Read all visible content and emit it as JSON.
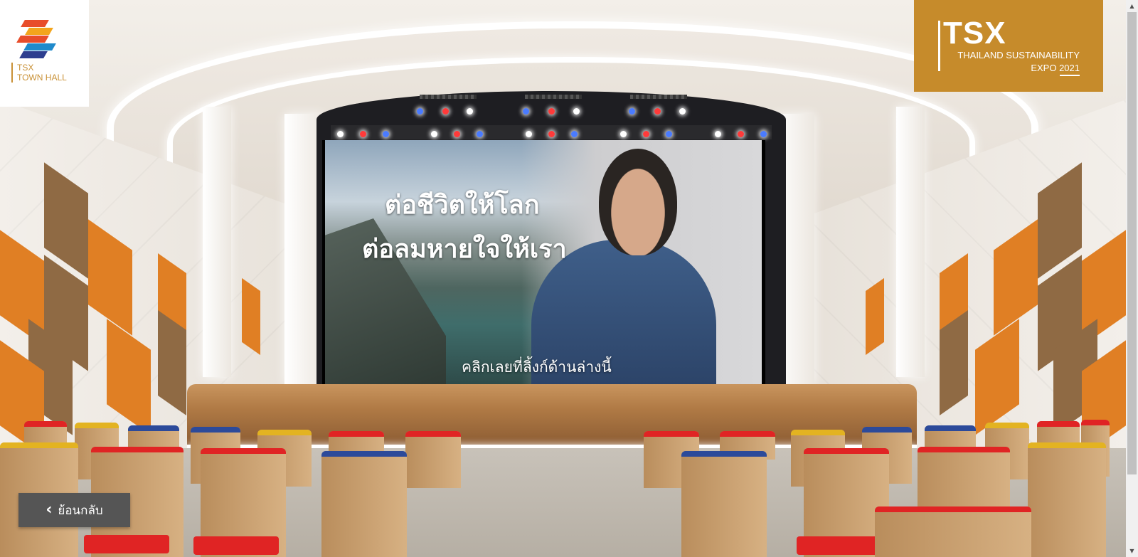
{
  "brand_left": {
    "line1": "TSX",
    "line2": "TOWN HALL",
    "colors": [
      "#e84d2a",
      "#f3a51c",
      "#1f8acb",
      "#2d3e8f",
      "#56b146"
    ]
  },
  "brand_right": {
    "big": "TSX",
    "line1": "THAILAND SUSTAINABILITY",
    "line2": "EXPO 2021",
    "background": "#c68b2b"
  },
  "screen": {
    "headline_line1": "ต่อชีวิตให้โลก",
    "headline_line2": "ต่อลมหายใจให้เรา",
    "caption": "คลิกเลยที่ลิ้งก์ด้านล่างนี้"
  },
  "back_button": {
    "label": "ย้อนกลับ",
    "icon": "chevron-left-icon"
  },
  "scrollbar": {
    "up_icon": "▲",
    "down_icon": "▼"
  }
}
